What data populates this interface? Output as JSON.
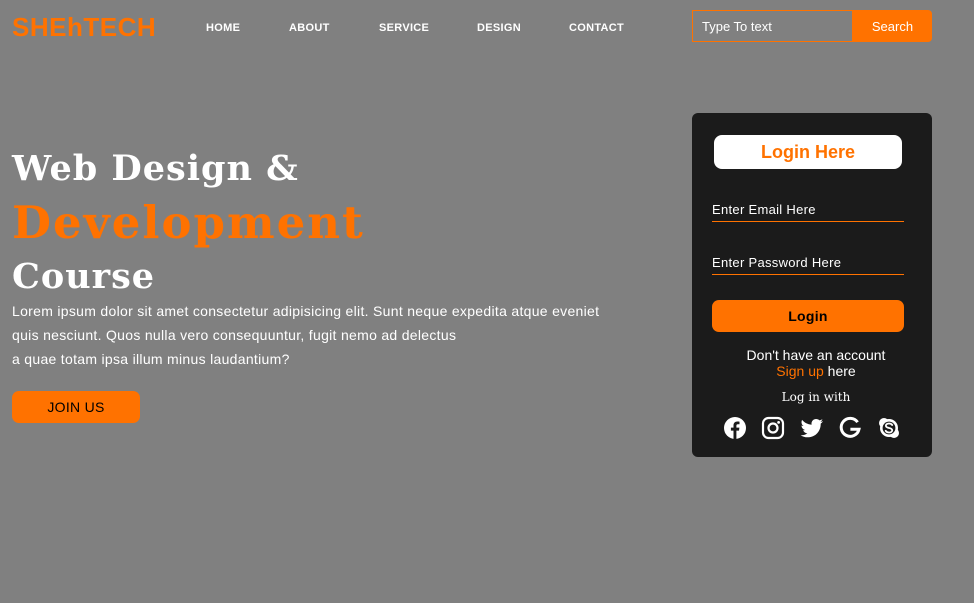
{
  "header": {
    "logo": "SHEhTECH",
    "nav": [
      "HOME",
      "ABOUT",
      "SERVICE",
      "DESIGN",
      "CONTACT"
    ],
    "search": {
      "placeholder": "Type To text",
      "button_label": "Search"
    }
  },
  "hero": {
    "line1": "Web Design &",
    "line2": "Development",
    "line3": "Course",
    "paragraph": [
      "Lorem ipsum dolor sit amet consectetur adipisicing elit. Sunt neque expedita atque eveniet",
      "quis nesciunt. Quos nulla vero consequuntur, fugit nemo ad delectus",
      "a quae totam ipsa illum minus laudantium?"
    ],
    "join_button": "JOIN US"
  },
  "login": {
    "title": "Login Here",
    "email_placeholder": "Enter Email Here",
    "password_placeholder": "Enter Password Here",
    "button_label": "Login",
    "no_account": "Don't have an account",
    "signup_link": "Sign up",
    "signup_suffix": "here",
    "login_with": "Log in with",
    "social_icons": [
      "facebook-icon",
      "instagram-icon",
      "twitter-icon",
      "google-icon",
      "skype-icon"
    ]
  },
  "colors": {
    "background": "#808080",
    "accent": "#ff7200",
    "card": "#1b1b1b",
    "text": "#ffffff"
  }
}
